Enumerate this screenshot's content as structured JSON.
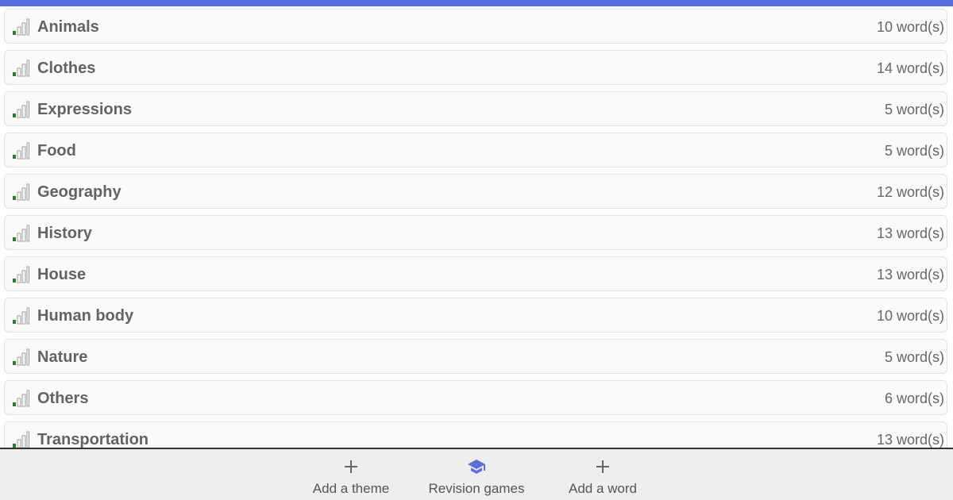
{
  "colors": {
    "accent": "#5b6ee1",
    "bar_filled": "#2e7d32",
    "bar_empty": "#9e9e9e"
  },
  "themes": [
    {
      "name": "Animals",
      "count": "10 word(s)"
    },
    {
      "name": "Clothes",
      "count": "14 word(s)"
    },
    {
      "name": "Expressions",
      "count": "5 word(s)"
    },
    {
      "name": "Food",
      "count": "5 word(s)"
    },
    {
      "name": "Geography",
      "count": "12 word(s)"
    },
    {
      "name": "History",
      "count": "13 word(s)"
    },
    {
      "name": "House",
      "count": "13 word(s)"
    },
    {
      "name": "Human body",
      "count": "10 word(s)"
    },
    {
      "name": "Nature",
      "count": "5 word(s)"
    },
    {
      "name": "Others",
      "count": "6 word(s)"
    },
    {
      "name": "Transportation",
      "count": "13 word(s)"
    }
  ],
  "progress_icon": "signal-bars-icon",
  "bottom_nav": {
    "add_theme": {
      "label": "Add a theme",
      "icon": "plus-icon"
    },
    "revision_games": {
      "label": "Revision games",
      "icon": "graduation-cap-icon"
    },
    "add_word": {
      "label": "Add a word",
      "icon": "plus-icon"
    }
  }
}
